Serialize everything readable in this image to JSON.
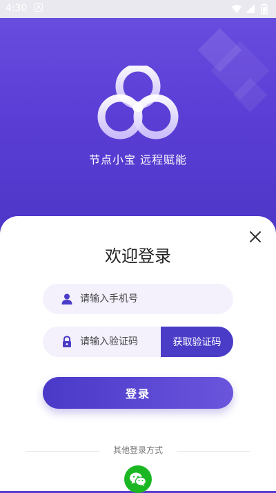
{
  "status_bar": {
    "time": "4:30",
    "notification_icon": "app-notification-icon",
    "right_icons": [
      "wifi-icon",
      "signal-icon",
      "battery-icon"
    ]
  },
  "hero": {
    "slogan": "节点小宝 远程赋能",
    "logo_icon": "app-logo-icon"
  },
  "login": {
    "title": "欢迎登录",
    "phone_placeholder": "请输入手机号",
    "phone_value": "",
    "code_placeholder": "请输入验证码",
    "code_value": "",
    "get_code_label": "获取验证码",
    "login_label": "登录",
    "other_methods_label": "其他登录方式",
    "close_icon": "close-icon",
    "wechat_icon": "wechat-icon"
  },
  "colors": {
    "hero_gradient_top": "#6b4fe0",
    "hero_gradient_bottom": "#4d36c7",
    "accent": "#4a3cc6",
    "field_background": "#f4f1fd",
    "wechat_green": "#1bb723"
  }
}
